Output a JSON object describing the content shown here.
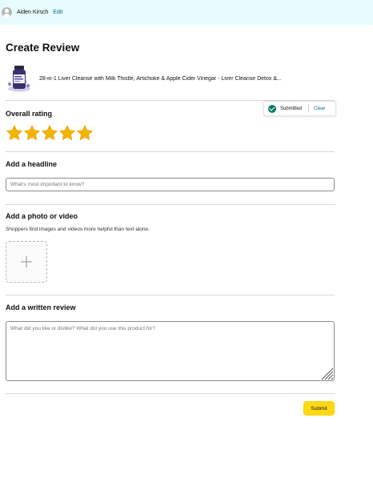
{
  "header": {
    "user_name": "Aiden Kirsch",
    "edit_label": "Edit",
    "background_color": "#e7fbfd"
  },
  "page_title": "Create Review",
  "product": {
    "title": "28-in-1 Liver Cleanse with Milk Thistle, Artichoke & Apple Cider Vinegar - Liver Cleanse Detox &..."
  },
  "rating": {
    "label": "Overall rating",
    "stars_filled": 5,
    "stars_total": 5,
    "star_color": "#f4b400",
    "status_text": "Submitted",
    "status_icon": "check-circle-icon",
    "clear_label": "Clear"
  },
  "headline": {
    "label": "Add a headline",
    "placeholder": "What's most important to know?",
    "value": ""
  },
  "media": {
    "label": "Add a photo or video",
    "hint": "Shoppers find images and videos more helpful than text alone.",
    "upload_icon": "plus-icon"
  },
  "review": {
    "label": "Add a written review",
    "placeholder": "What did you like or dislike? What did you use this product for?",
    "value": ""
  },
  "submit_label": "Submit",
  "accent_colors": {
    "link": "#007185",
    "submit_button": "#ffd814",
    "success": "#067d62"
  }
}
